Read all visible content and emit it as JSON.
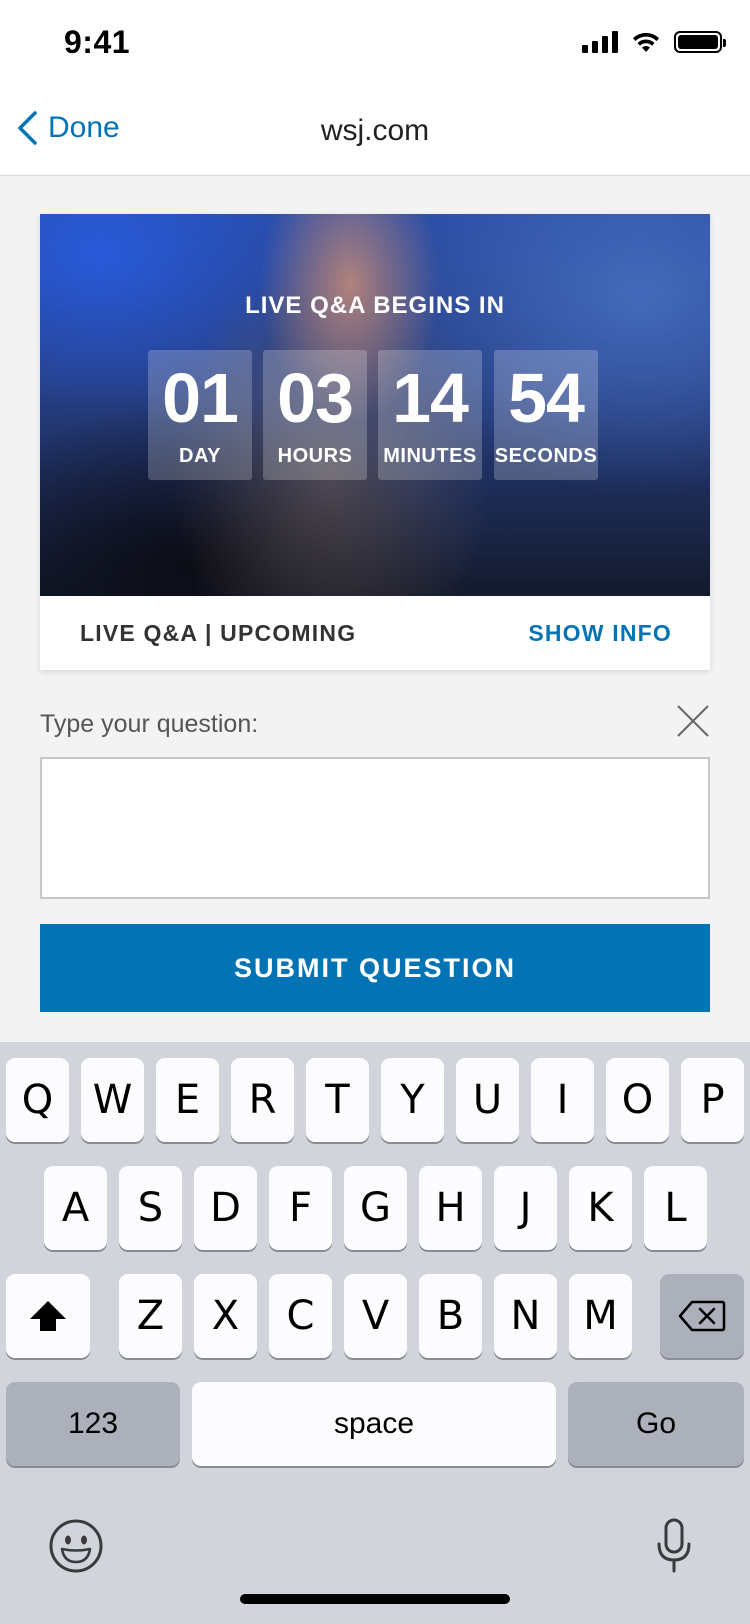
{
  "status_bar": {
    "time": "9:41"
  },
  "nav": {
    "back_label": "Done",
    "title": "wsj.com"
  },
  "hero": {
    "caption": "LIVE Q&A BEGINS IN",
    "countdown": [
      {
        "value": "01",
        "unit": "DAY"
      },
      {
        "value": "03",
        "unit": "HOURS"
      },
      {
        "value": "14",
        "unit": "MINUTES"
      },
      {
        "value": "54",
        "unit": "SECONDS"
      }
    ]
  },
  "card_footer": {
    "status": "LIVE Q&A | UPCOMING",
    "show_info": "SHOW INFO"
  },
  "question_form": {
    "label": "Type your question:",
    "input_value": "",
    "submit_label": "SUBMIT QUESTION"
  },
  "keyboard": {
    "row1": [
      "Q",
      "W",
      "E",
      "R",
      "T",
      "Y",
      "U",
      "I",
      "O",
      "P"
    ],
    "row2": [
      "A",
      "S",
      "D",
      "F",
      "G",
      "H",
      "J",
      "K",
      "L"
    ],
    "row3": [
      "Z",
      "X",
      "C",
      "V",
      "B",
      "N",
      "M"
    ],
    "numbers_key": "123",
    "space_key": "space",
    "go_key": "Go"
  },
  "colors": {
    "accent": "#0274b6",
    "keyboard_bg": "#d1d4db"
  }
}
